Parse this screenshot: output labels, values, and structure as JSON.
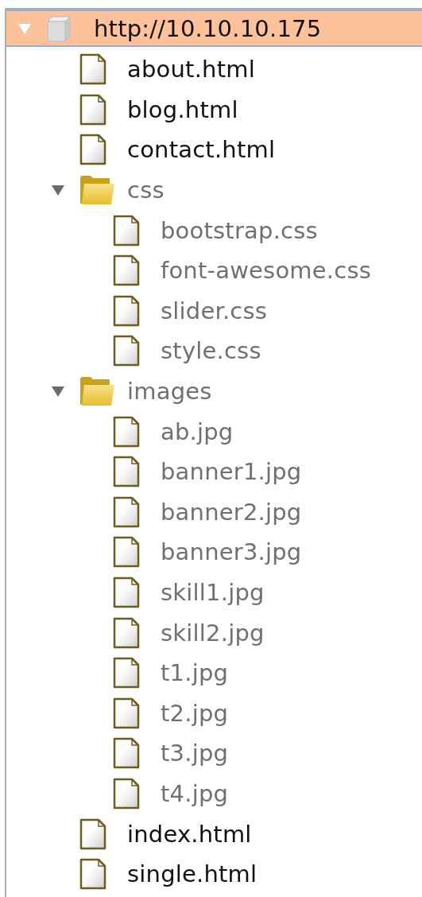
{
  "site_map": {
    "root": {
      "kind": "host",
      "label": "http://10.10.10.175",
      "selected": true,
      "expanded": true,
      "dimmed": false,
      "children": [
        {
          "kind": "file",
          "label": "about.html",
          "selected": false,
          "dimmed": false
        },
        {
          "kind": "file",
          "label": "blog.html",
          "selected": false,
          "dimmed": false
        },
        {
          "kind": "file",
          "label": "contact.html",
          "selected": false,
          "dimmed": false
        },
        {
          "kind": "folder",
          "label": "css",
          "selected": false,
          "expanded": true,
          "dimmed": true,
          "children": [
            {
              "kind": "file",
              "label": "bootstrap.css",
              "selected": false,
              "dimmed": true
            },
            {
              "kind": "file",
              "label": "font-awesome.css",
              "selected": false,
              "dimmed": true
            },
            {
              "kind": "file",
              "label": "slider.css",
              "selected": false,
              "dimmed": true
            },
            {
              "kind": "file",
              "label": "style.css",
              "selected": false,
              "dimmed": true
            }
          ]
        },
        {
          "kind": "folder",
          "label": "images",
          "selected": false,
          "expanded": true,
          "dimmed": true,
          "children": [
            {
              "kind": "file",
              "label": "ab.jpg",
              "selected": false,
              "dimmed": true
            },
            {
              "kind": "file",
              "label": "banner1.jpg",
              "selected": false,
              "dimmed": true
            },
            {
              "kind": "file",
              "label": "banner2.jpg",
              "selected": false,
              "dimmed": true
            },
            {
              "kind": "file",
              "label": "banner3.jpg",
              "selected": false,
              "dimmed": true
            },
            {
              "kind": "file",
              "label": "skill1.jpg",
              "selected": false,
              "dimmed": true
            },
            {
              "kind": "file",
              "label": "skill2.jpg",
              "selected": false,
              "dimmed": true
            },
            {
              "kind": "file",
              "label": "t1.jpg",
              "selected": false,
              "dimmed": true
            },
            {
              "kind": "file",
              "label": "t2.jpg",
              "selected": false,
              "dimmed": true
            },
            {
              "kind": "file",
              "label": "t3.jpg",
              "selected": false,
              "dimmed": true
            },
            {
              "kind": "file",
              "label": "t4.jpg",
              "selected": false,
              "dimmed": true
            }
          ]
        },
        {
          "kind": "file",
          "label": "index.html",
          "selected": false,
          "dimmed": false
        },
        {
          "kind": "file",
          "label": "single.html",
          "selected": false,
          "dimmed": false
        }
      ]
    }
  }
}
